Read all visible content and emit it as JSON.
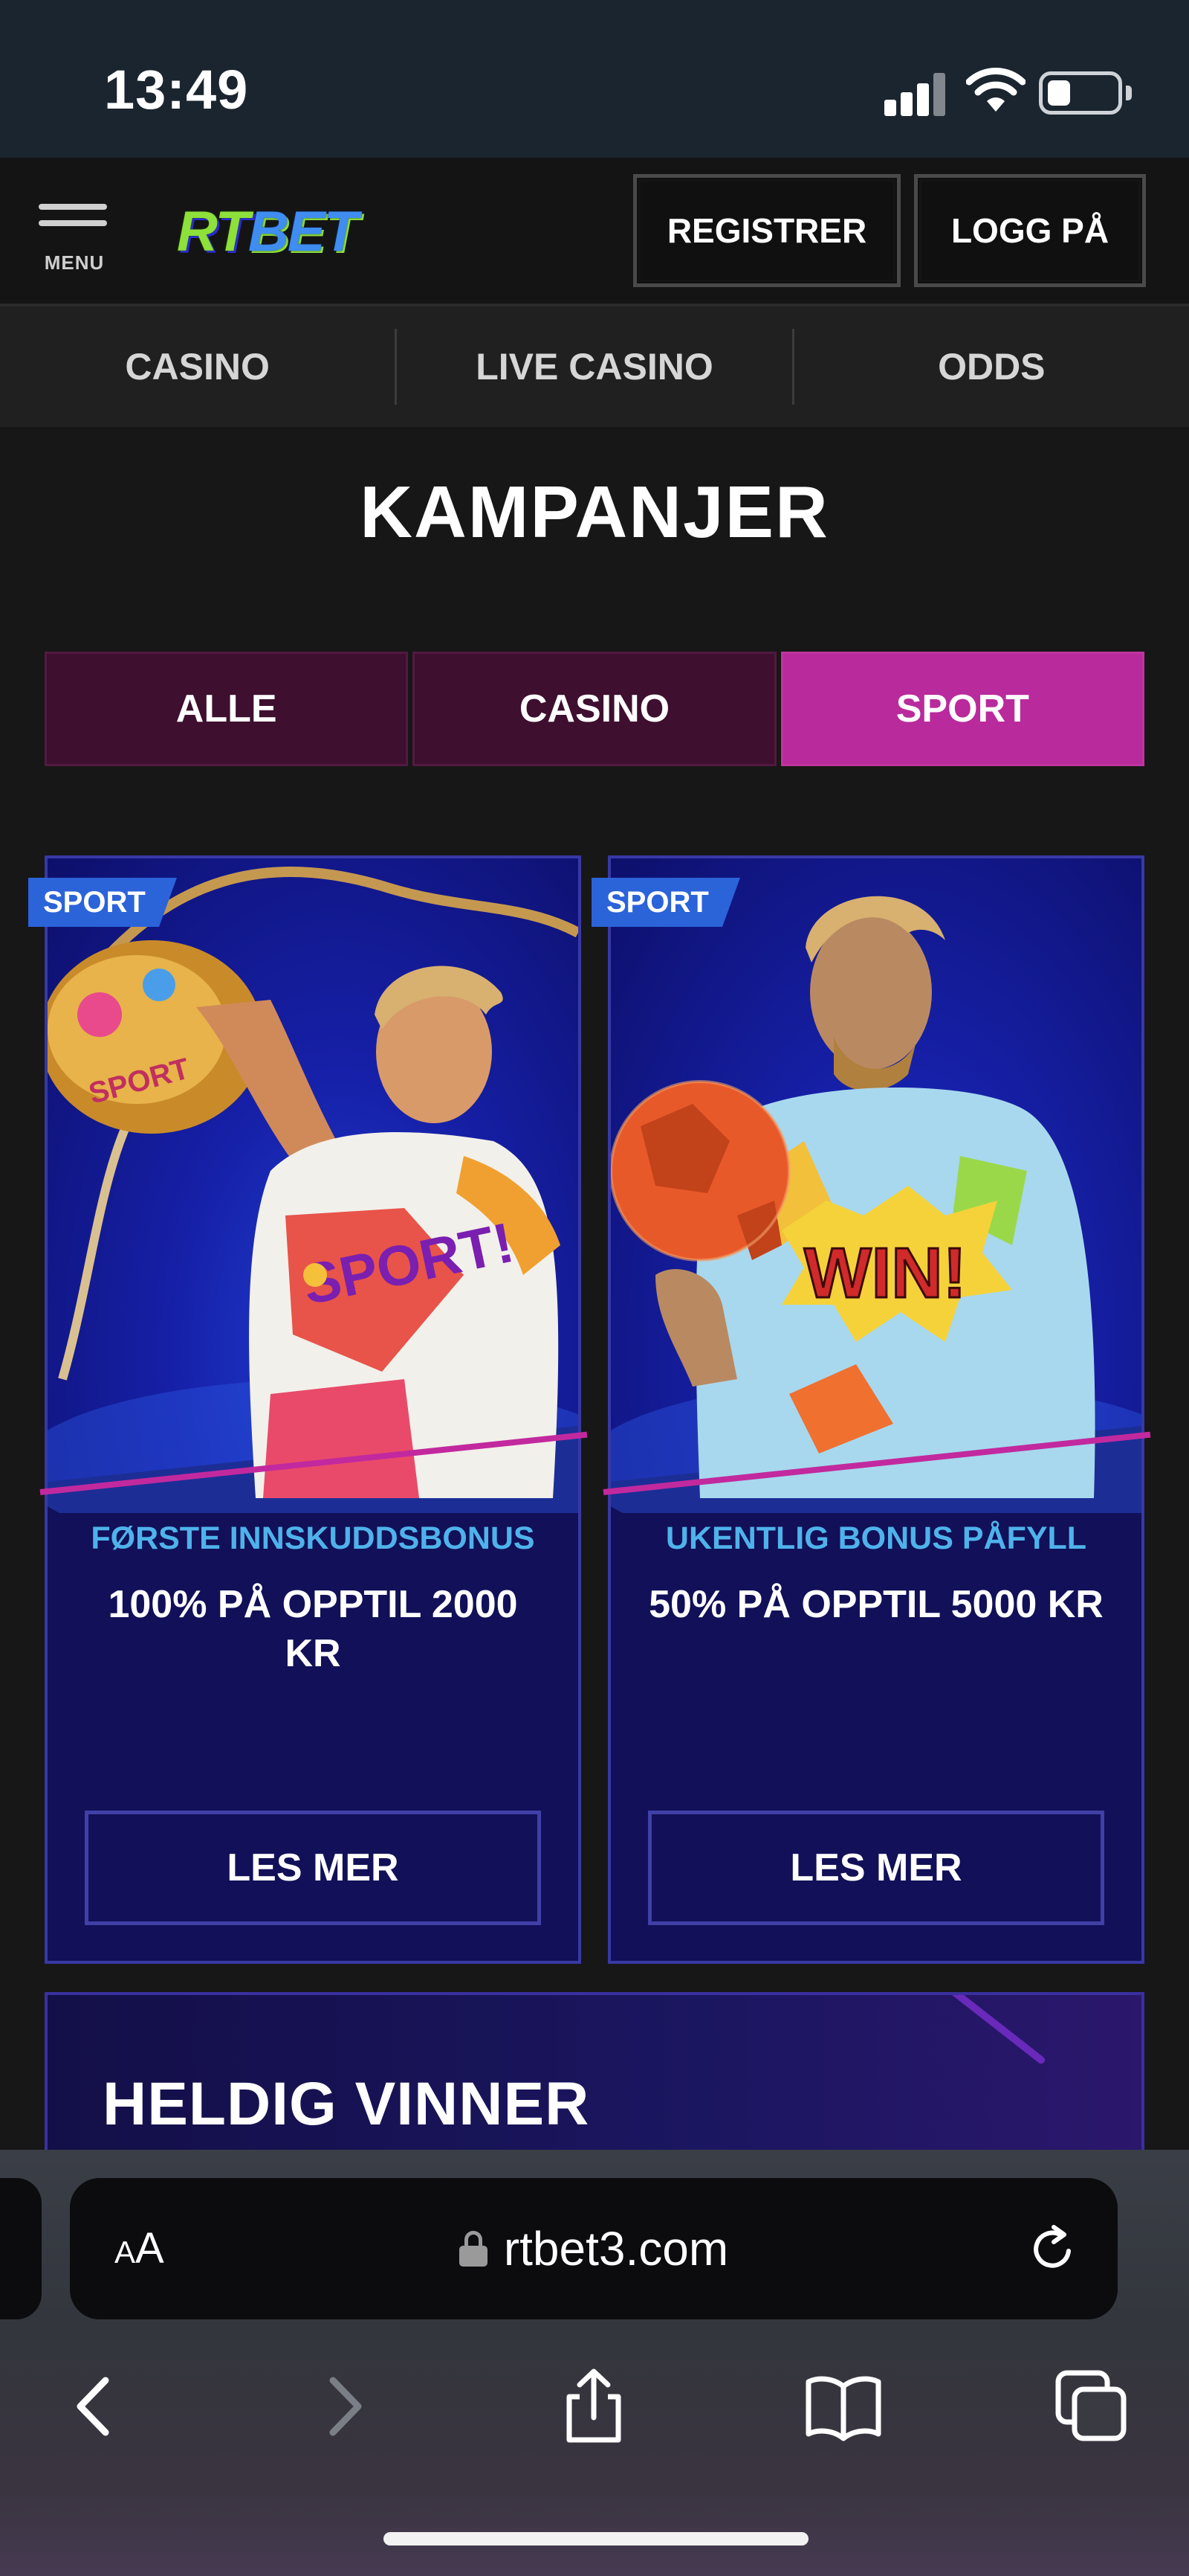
{
  "status_bar": {
    "time": "13:49"
  },
  "header": {
    "menu_label": "MENU",
    "logo_rt": "RT",
    "logo_bet": "BET",
    "register_label": "REGISTRER",
    "login_label": "LOGG PÅ"
  },
  "category_nav": {
    "items": [
      {
        "label": "CASINO"
      },
      {
        "label": "LIVE CASINO"
      },
      {
        "label": "ODDS"
      }
    ]
  },
  "page_title": "KAMPANJER",
  "filter_tabs": {
    "items": [
      {
        "label": "ALLE",
        "active": false
      },
      {
        "label": "CASINO",
        "active": false
      },
      {
        "label": "SPORT",
        "active": true
      }
    ]
  },
  "promos": [
    {
      "badge": "SPORT",
      "subtitle": "FØRSTE INNSKUDDSBONUS",
      "headline": "100% PÅ OPPTIL 2000 KR",
      "button_label": "LES MER"
    },
    {
      "badge": "SPORT",
      "subtitle": "UKENTLIG BONUS PÅFYLL",
      "headline": "50% PÅ OPPTIL 5000 KR",
      "button_label": "LES MER"
    }
  ],
  "winner_banner": {
    "title": "HELDIG VINNER"
  },
  "browser": {
    "text_size_label_small": "A",
    "text_size_label_large": "A",
    "url": "rtbet3.com"
  },
  "colors": {
    "accent_pink": "#b92a9c",
    "card_navy": "#111058",
    "badge_blue": "#2b63d9",
    "subtitle_cyan": "#4fb2ea"
  },
  "icons": [
    "signal-icon",
    "wifi-icon",
    "battery-icon",
    "menu-icon",
    "lock-icon",
    "reload-icon",
    "back-icon",
    "forward-icon",
    "share-icon",
    "bookmarks-icon",
    "tabs-icon"
  ]
}
